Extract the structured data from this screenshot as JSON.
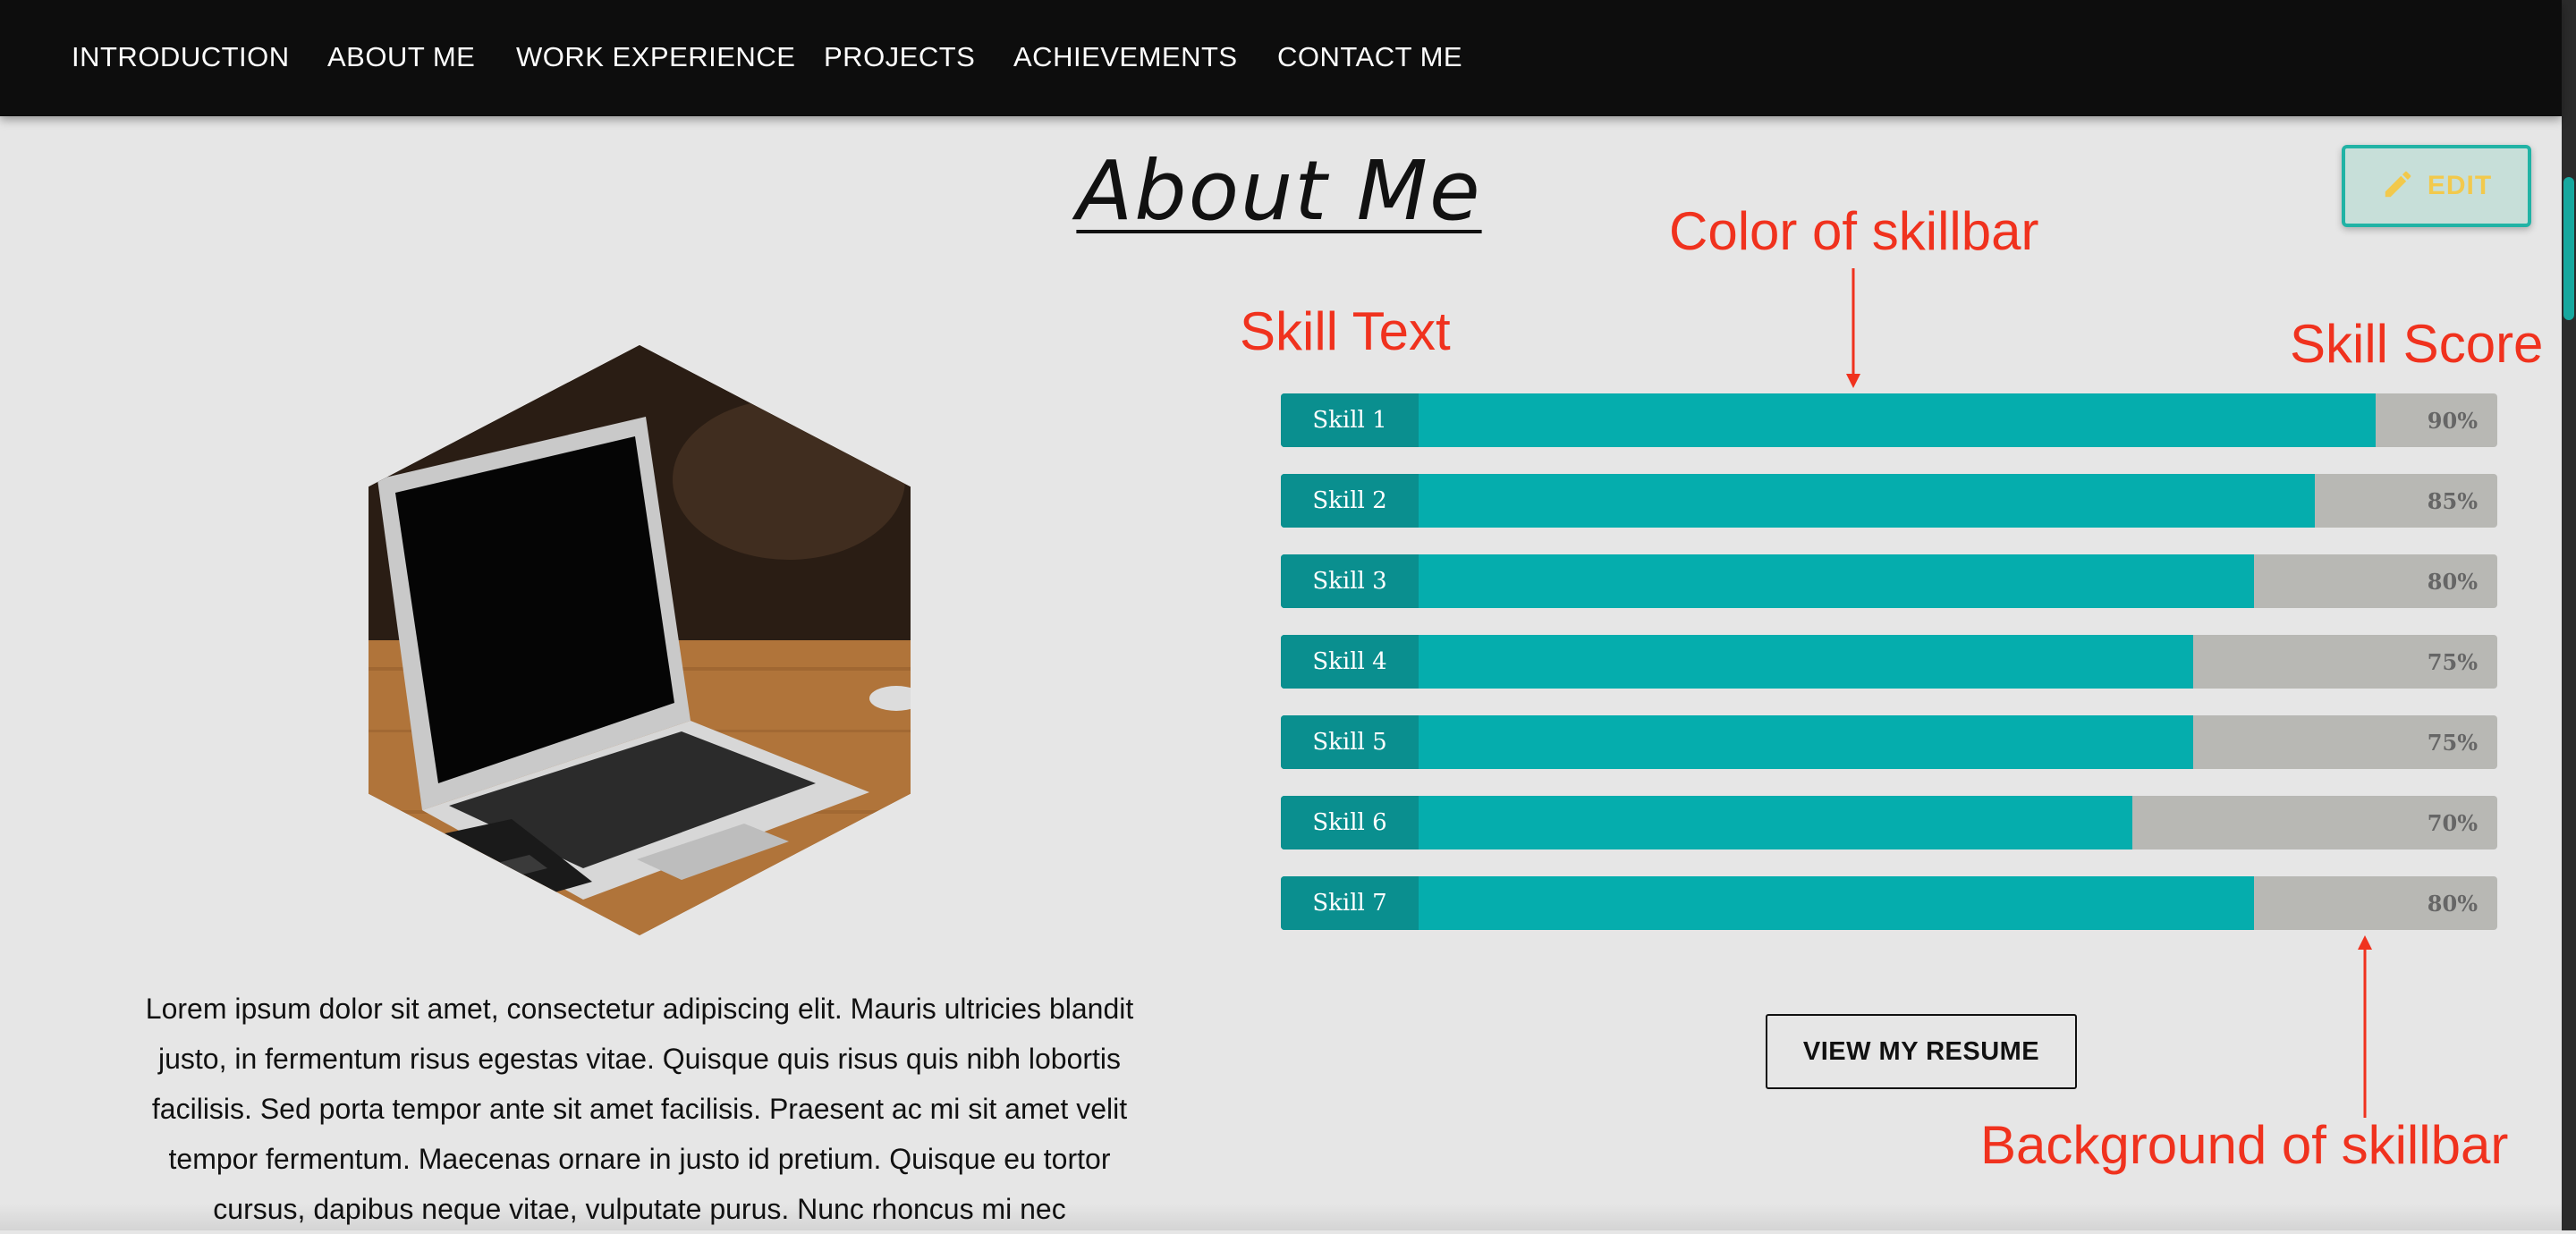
{
  "nav": {
    "items": [
      "INTRODUCTION",
      "ABOUT ME",
      "WORK EXPERIENCE",
      "PROJECTS",
      "ACHIEVEMENTS",
      "CONTACT ME"
    ]
  },
  "section": {
    "title": "About Me",
    "edit_label": "EDIT"
  },
  "about": {
    "paragraph": "Lorem ipsum dolor sit amet, consectetur adipiscing elit. Mauris ultricies blandit justo, in fermentum risus egestas vitae. Quisque quis risus quis nibh lobortis facilisis. Sed porta tempor ante sit amet facilisis. Praesent ac mi sit amet velit tempor fermentum. Maecenas ornare in justo id pretium. Quisque eu tortor cursus, dapibus neque vitae, vulputate purus. Nunc rhoncus mi nec"
  },
  "annotations": {
    "skill_text": "Skill Text",
    "bar_color": "Color of skillbar",
    "skill_score": "Skill Score",
    "bar_background": "Background of skillbar"
  },
  "skills": [
    {
      "label": "Skill 1",
      "score": "90%",
      "value": 90
    },
    {
      "label": "Skill 2",
      "score": "85%",
      "value": 85
    },
    {
      "label": "Skill 3",
      "score": "80%",
      "value": 80
    },
    {
      "label": "Skill 4",
      "score": "75%",
      "value": 75
    },
    {
      "label": "Skill 5",
      "score": "75%",
      "value": 75
    },
    {
      "label": "Skill 6",
      "score": "70%",
      "value": 70
    },
    {
      "label": "Skill 7",
      "score": "80%",
      "value": 80
    }
  ],
  "resume_button": "VIEW MY RESUME",
  "colors": {
    "nav_bg": "#0d0d0d",
    "page_bg": "#e6e6e6",
    "bar_fill": "#05adad",
    "bar_label": "#0a8f8f",
    "bar_track": "#b8b8b4",
    "annotation": "#f0321e",
    "edit_accent": "#21b3a5"
  },
  "icons": {
    "edit": "pencil-icon"
  }
}
